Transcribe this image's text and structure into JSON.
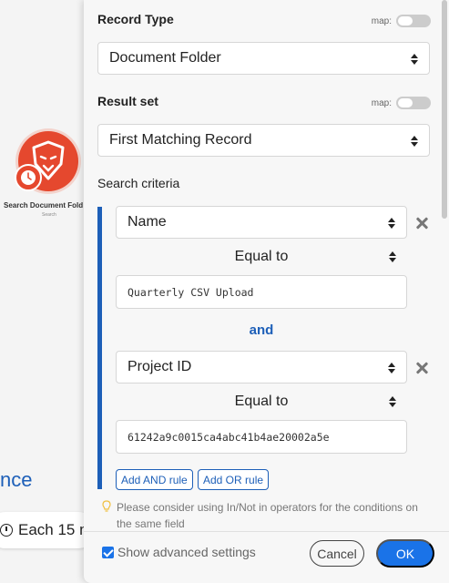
{
  "background": {
    "module_label": "Search Document Fold",
    "module_sublabel": "Search",
    "link_fragment": "nce",
    "schedule_text": "Each 15 m"
  },
  "panel": {
    "record_type": {
      "title": "Record Type",
      "map_label": "map:",
      "value": "Document Folder"
    },
    "result_set": {
      "title": "Result set",
      "map_label": "map:",
      "value": "First Matching Record"
    },
    "search_criteria": {
      "title": "Search criteria",
      "conditions": [
        {
          "field": "Name",
          "operator": "Equal to",
          "value": "Quarterly CSV Upload"
        },
        {
          "field": "Project ID",
          "operator": "Equal to",
          "value": "61242a9c0015ca4abc41b4ae20002a5e"
        }
      ],
      "conjunction": "and",
      "add_and_label": "Add AND rule",
      "add_or_label": "Add OR rule"
    },
    "hint": "Please consider using In/Not in operators for the conditions on the same field",
    "advanced_label": "Show advanced settings",
    "advanced_checked": true,
    "cancel_label": "Cancel",
    "ok_label": "OK"
  },
  "colors": {
    "accent": "#1d5fb8",
    "primary_button": "#1a73e8",
    "module": "#e5482e"
  }
}
